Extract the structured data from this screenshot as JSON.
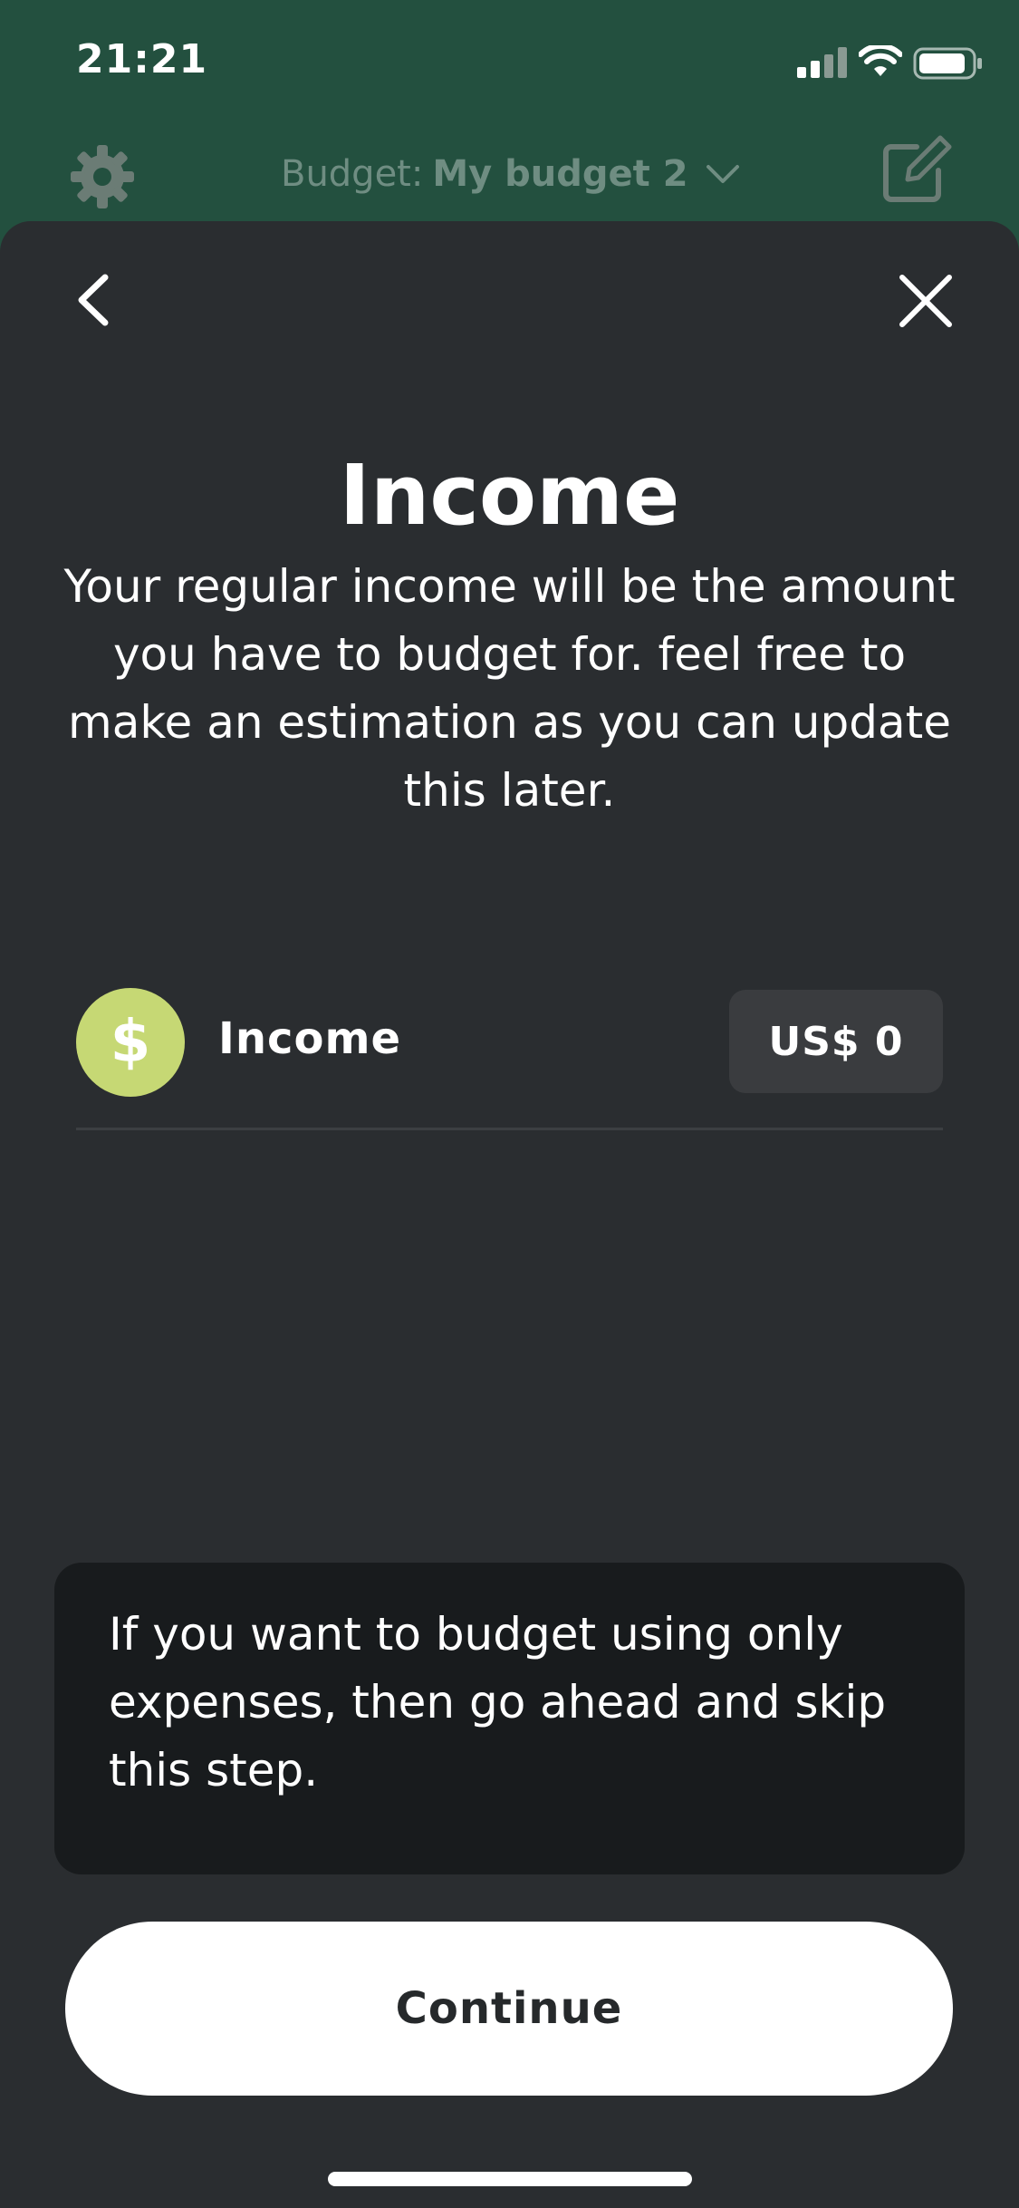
{
  "status_bar": {
    "time": "21:21"
  },
  "header": {
    "budget_prefix": "Budget:",
    "budget_name": "My budget 2"
  },
  "page": {
    "title": "Income",
    "subtitle": "Your regular income will be the amount you have to budget for. feel free to make an estimation as you can update this later."
  },
  "income_row": {
    "icon_symbol": "$",
    "icon_color": "#c6d874",
    "label": "Income",
    "amount": "US$ 0"
  },
  "info": {
    "text": "If you want to budget using only expenses, then go ahead and skip this step."
  },
  "actions": {
    "continue_label": "Continue"
  },
  "icons": {
    "settings": "gear-icon",
    "dropdown": "chevron-down-icon",
    "edit": "edit-icon",
    "back": "back-icon",
    "close": "close-icon"
  },
  "colors": {
    "header_bg": "#23503f",
    "sheet_bg": "#2a2d30",
    "info_bg": "#181b1d",
    "accent_green": "#c6d874"
  }
}
